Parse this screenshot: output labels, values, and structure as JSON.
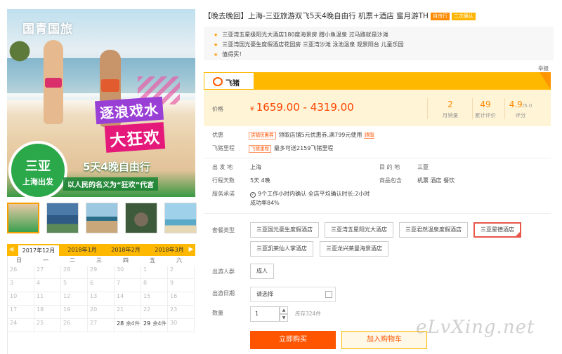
{
  "hero": {
    "brand": "国青国旅",
    "headline1": "逐浪戏水",
    "headline2": "大狂欢",
    "destination": "三亚",
    "departure": "上海出发",
    "duration": "5天4晚自由行",
    "slogan": "以人民的名义为“狂欢”代言"
  },
  "calendar": {
    "months": [
      "2017年12月",
      "2018年1月",
      "2018年2月",
      "2018年3月"
    ],
    "active_month": 0,
    "weekdays": [
      "日",
      "一",
      "二",
      "三",
      "四",
      "五",
      "六"
    ],
    "rows": [
      [
        "26",
        "27",
        "28",
        "29",
        "30",
        "1",
        "2"
      ],
      [
        "3",
        "4",
        "5",
        "6",
        "7",
        "8",
        "9"
      ],
      [
        "10",
        "11",
        "12",
        "13",
        "14",
        "15",
        "16"
      ],
      [
        "17",
        "18",
        "19",
        "20",
        "21",
        "22",
        "23"
      ],
      [
        "24",
        "25",
        "26",
        "27",
        "28",
        "29",
        "30"
      ]
    ],
    "available": [
      {
        "row": 4,
        "col": 4,
        "remain": "余4件"
      },
      {
        "row": 4,
        "col": 5,
        "remain": "余4件"
      }
    ]
  },
  "product": {
    "title": "【晚去晚回】上海-三亚旅游双飞5天4晚自由行 机票+酒店 蜜月游TH",
    "tags": [
      "自由行",
      "二次确认"
    ],
    "features": [
      "三亚湾五星级阳光大酒店180度海景房 蹭小鱼温泉 过马路就是沙滩",
      "三亚湾国光豪生度假酒店花园房 三亚湾沙滩 泳池温泉 观景阳台 儿童乐园",
      "值得买！"
    ],
    "report": "举报",
    "platform": "飞猪"
  },
  "price": {
    "label": "价格",
    "currency": "¥",
    "range": "1659.00 - 4319.00",
    "sales_value": "2",
    "sales_label": "月销量",
    "reviews_value": "49",
    "reviews_label": "累计评价",
    "rating_value": "4.9",
    "rating_suffix": "/5.0",
    "rating_label": "评分"
  },
  "promo": {
    "label": "优惠",
    "badge": "店铺优惠券",
    "text": "领取店铺5元优惠券,满799元使用",
    "link": "领取",
    "miles_label": "飞猪里程",
    "miles_badge": "飞猪里程",
    "miles_text": "最多可送2159飞猪里程"
  },
  "info": {
    "from_label": "出 发 地",
    "from": "上海",
    "to_label": "目 的 地",
    "to": "三亚",
    "days_label": "行程天数",
    "days": "5天  4晚",
    "includes_label": "商品包含",
    "includes": "机票  酒店  餐饮",
    "service_label": "服务承诺",
    "service_line1": "9个工作小时内确认 全店平均确认时长:2小时",
    "service_line2": "成功率84%"
  },
  "options": {
    "package_label": "套餐类型",
    "packages": [
      "三亚国光豪生度假酒店",
      "三亚湾五星阳光大酒店",
      "三亚君然温泉度假酒店",
      "三亚星德酒店",
      "三亚凯莱仙人掌酒店",
      "三亚龙兴莱曼海景酒店"
    ],
    "selected_package": 3,
    "people_label": "出游人群",
    "people_value": "成人",
    "date_label": "出游日期",
    "date_placeholder": "请选择",
    "qty_label": "数量",
    "qty_value": "1",
    "stock": "库存324件",
    "buy": "立即购买",
    "cart": "加入购物车"
  },
  "watermark": "eLvXing.net",
  "colors": {
    "accent": "#ff5400",
    "brand_yellow": "#ffb800",
    "price": "#ff4200"
  }
}
